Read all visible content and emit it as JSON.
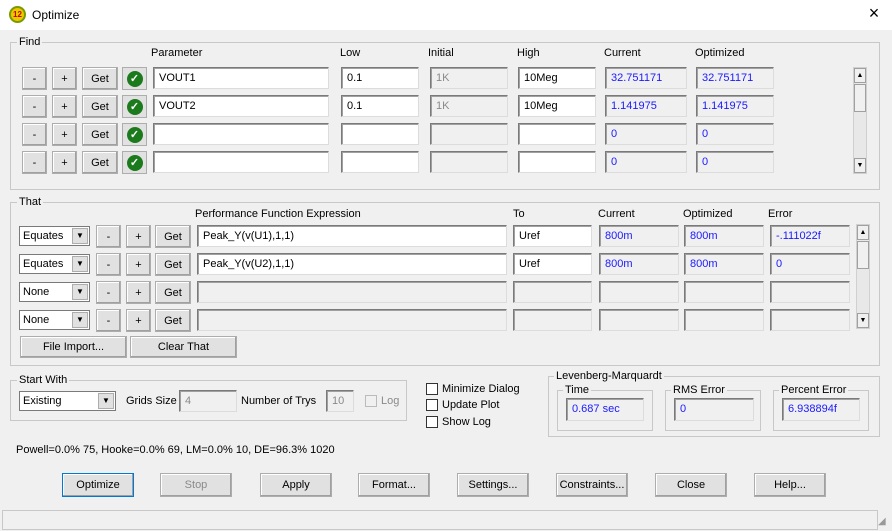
{
  "window": {
    "title": "Optimize",
    "close": "×",
    "icon_text": "12"
  },
  "find": {
    "label": "Find",
    "headers": {
      "parameter": "Parameter",
      "low": "Low",
      "initial": "Initial",
      "high": "High",
      "current": "Current",
      "optimized": "Optimized"
    },
    "minus": "-",
    "plus": "+",
    "get": "Get",
    "rows": [
      {
        "parameter": "VOUT1",
        "low": "0.1",
        "initial": "1K",
        "high": "10Meg",
        "current": "32.751171",
        "optimized": "32.751171"
      },
      {
        "parameter": "VOUT2",
        "low": "0.1",
        "initial": "1K",
        "high": "10Meg",
        "current": "1.141975",
        "optimized": "1.141975"
      },
      {
        "parameter": "",
        "low": "",
        "initial": "",
        "high": "",
        "current": "0",
        "optimized": "0"
      },
      {
        "parameter": "",
        "low": "",
        "initial": "",
        "high": "",
        "current": "0",
        "optimized": "0"
      }
    ]
  },
  "that": {
    "label": "That",
    "headers": {
      "expression": "Performance Function Expression",
      "to": "To",
      "current": "Current",
      "optimized": "Optimized",
      "error": "Error"
    },
    "minus": "-",
    "plus": "+",
    "get": "Get",
    "rows": [
      {
        "mode": "Equates",
        "expression": "Peak_Y(v(U1),1,1)",
        "to": "Uref",
        "current": "800m",
        "optimized": "800m",
        "error": "-.111022f"
      },
      {
        "mode": "Equates",
        "expression": "Peak_Y(v(U2),1,1)",
        "to": "Uref",
        "current": "800m",
        "optimized": "800m",
        "error": "0"
      },
      {
        "mode": "None",
        "expression": "",
        "to": "",
        "current": "",
        "optimized": "",
        "error": ""
      },
      {
        "mode": "None",
        "expression": "",
        "to": "",
        "current": "",
        "optimized": "",
        "error": ""
      }
    ],
    "file_import": "File Import...",
    "clear_that": "Clear That"
  },
  "start_with": {
    "label": "Start With",
    "value": "Existing",
    "grids_size_label": "Grids Size",
    "grids_size": "4",
    "trys_label": "Number of Trys",
    "trys": "10",
    "log_label": "Log"
  },
  "options": {
    "minimize_dialog": "Minimize Dialog",
    "update_plot": "Update Plot",
    "show_log": "Show Log"
  },
  "lm": {
    "label": "Levenberg-Marquardt",
    "time_label": "Time",
    "time": "0.687 sec",
    "rms_label": "RMS Error",
    "rms": "0",
    "percent_label": "Percent Error",
    "percent": "6.938894f"
  },
  "status": "Powell=0.0% 75, Hooke=0.0% 69, LM=0.0% 10, DE=96.3% 1020",
  "buttons": {
    "optimize": "Optimize",
    "stop": "Stop",
    "apply": "Apply",
    "format": "Format...",
    "settings": "Settings...",
    "constraints": "Constraints...",
    "close": "Close",
    "help": "Help..."
  },
  "colors": {
    "value_text": "#1a1aff",
    "check": "#1b7a1b"
  }
}
